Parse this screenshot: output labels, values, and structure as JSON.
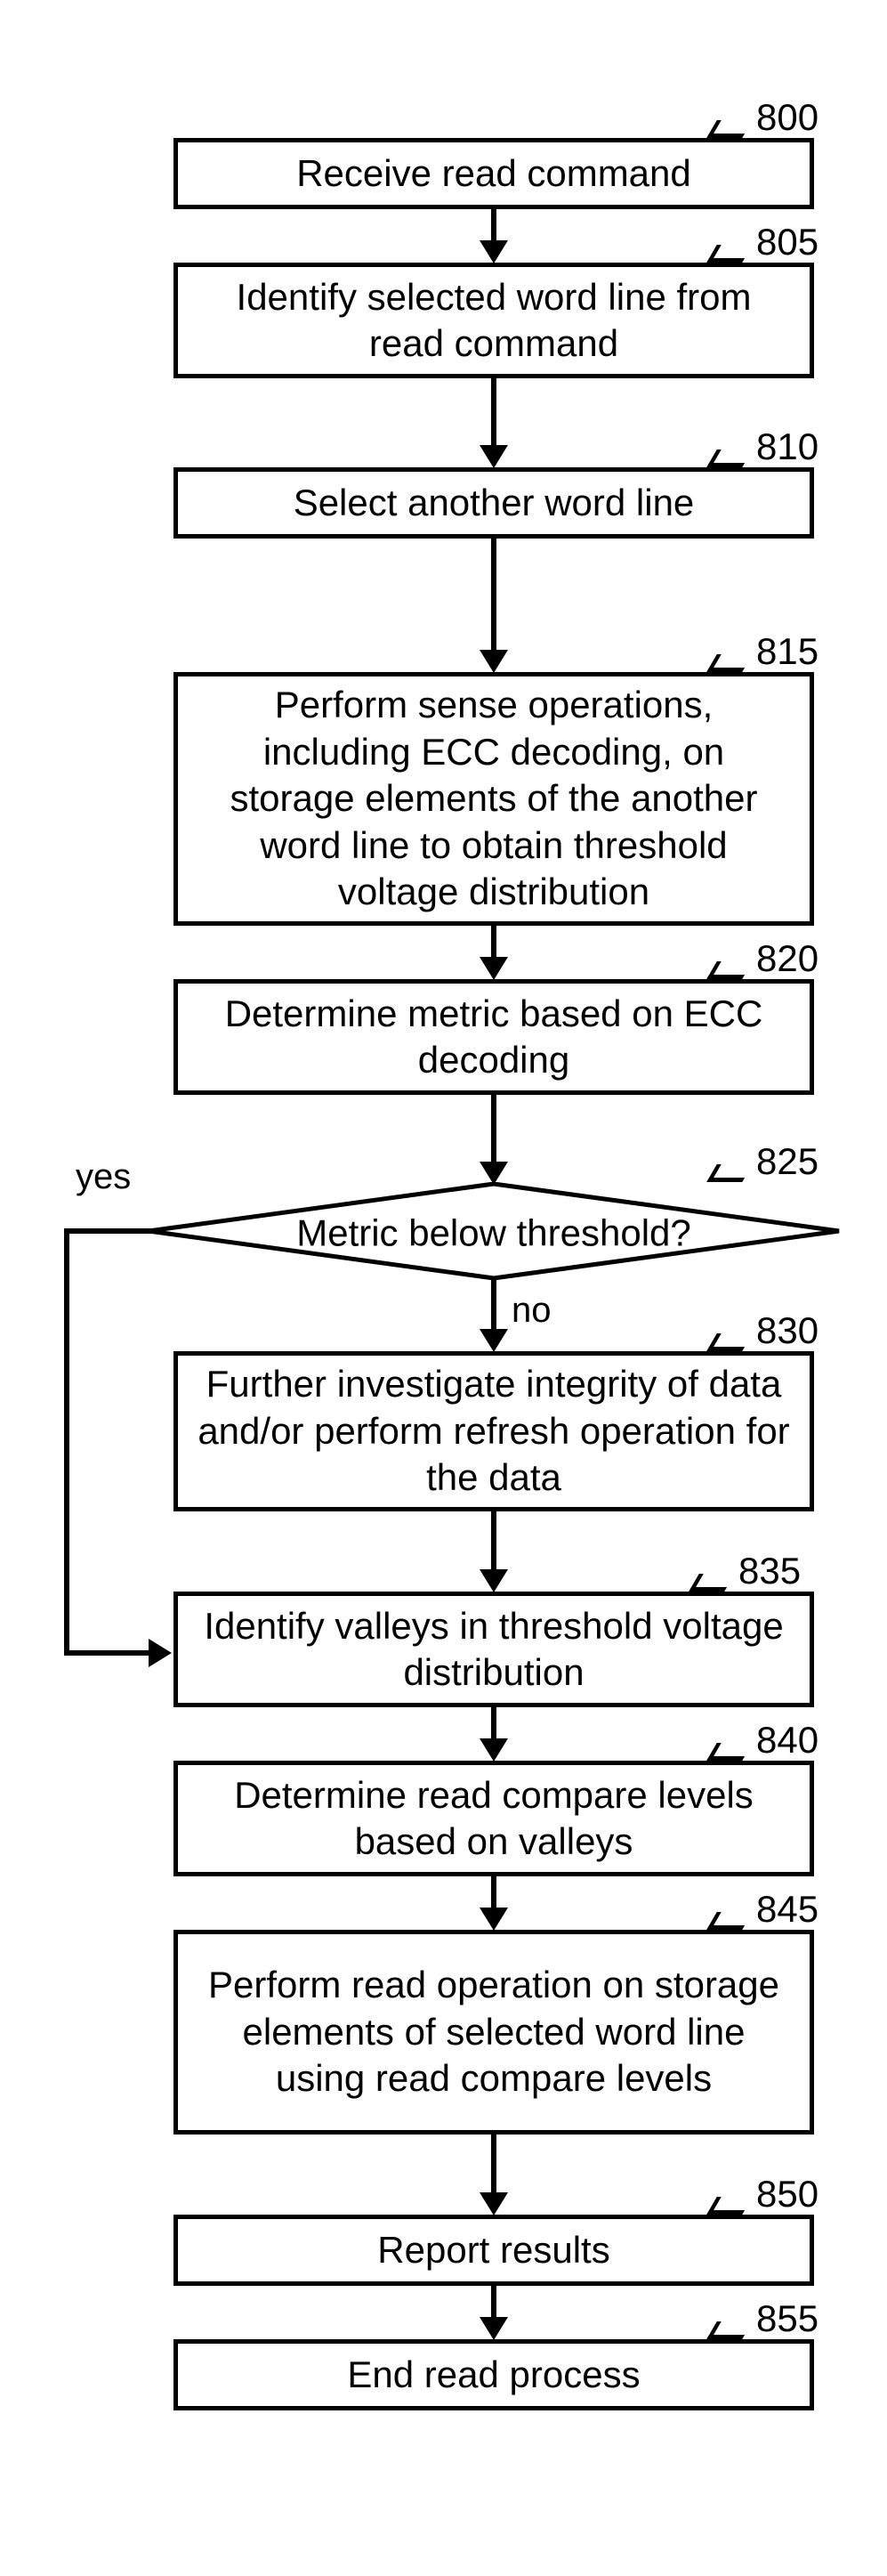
{
  "chart_data": {
    "type": "flowchart",
    "nodes": [
      {
        "id": "800",
        "type": "process",
        "text": "Receive read command"
      },
      {
        "id": "805",
        "type": "process",
        "text": "Identify selected word line from read command"
      },
      {
        "id": "810",
        "type": "process",
        "text": "Select another word line"
      },
      {
        "id": "815",
        "type": "process",
        "text": "Perform sense operations, including ECC decoding, on storage elements of the another word line to obtain threshold voltage distribution"
      },
      {
        "id": "820",
        "type": "process",
        "text": "Determine metric based on ECC decoding"
      },
      {
        "id": "825",
        "type": "decision",
        "text": "Metric below threshold?"
      },
      {
        "id": "830",
        "type": "process",
        "text": "Further investigate integrity of data and/or perform refresh operation for the data"
      },
      {
        "id": "835",
        "type": "process",
        "text": "Identify valleys in threshold voltage distribution"
      },
      {
        "id": "840",
        "type": "process",
        "text": "Determine read compare levels based on valleys"
      },
      {
        "id": "845",
        "type": "process",
        "text": "Perform read operation on storage elements of selected word line using read compare levels"
      },
      {
        "id": "850",
        "type": "process",
        "text": "Report results"
      },
      {
        "id": "855",
        "type": "process",
        "text": "End read process"
      }
    ],
    "edges": [
      {
        "from": "800",
        "to": "805"
      },
      {
        "from": "805",
        "to": "810"
      },
      {
        "from": "810",
        "to": "815"
      },
      {
        "from": "815",
        "to": "820"
      },
      {
        "from": "820",
        "to": "825"
      },
      {
        "from": "825",
        "to": "830",
        "label": "no"
      },
      {
        "from": "825",
        "to": "835",
        "label": "yes"
      },
      {
        "from": "830",
        "to": "835"
      },
      {
        "from": "835",
        "to": "840"
      },
      {
        "from": "840",
        "to": "845"
      },
      {
        "from": "845",
        "to": "850"
      },
      {
        "from": "850",
        "to": "855"
      }
    ]
  },
  "nodes": {
    "n800": {
      "num": "800",
      "text": "Receive read command"
    },
    "n805": {
      "num": "805",
      "text": "Identify selected word line from read command"
    },
    "n810": {
      "num": "810",
      "text": "Select another word line"
    },
    "n815": {
      "num": "815",
      "text": "Perform sense operations, including ECC decoding, on storage elements of the another word line to obtain threshold voltage distribution"
    },
    "n820": {
      "num": "820",
      "text": "Determine metric based on ECC decoding"
    },
    "n825": {
      "num": "825",
      "text": "Metric below threshold?"
    },
    "n830": {
      "num": "830",
      "text": "Further investigate integrity of data and/or perform refresh operation for the data"
    },
    "n835": {
      "num": "835",
      "text": "Identify valleys in threshold voltage distribution"
    },
    "n840": {
      "num": "840",
      "text": "Determine read compare levels based on valleys"
    },
    "n845": {
      "num": "845",
      "text": "Perform read operation on storage elements of selected word line using read compare levels"
    },
    "n850": {
      "num": "850",
      "text": "Report results"
    },
    "n855": {
      "num": "855",
      "text": "End read process"
    }
  },
  "branches": {
    "yes": "yes",
    "no": "no"
  }
}
